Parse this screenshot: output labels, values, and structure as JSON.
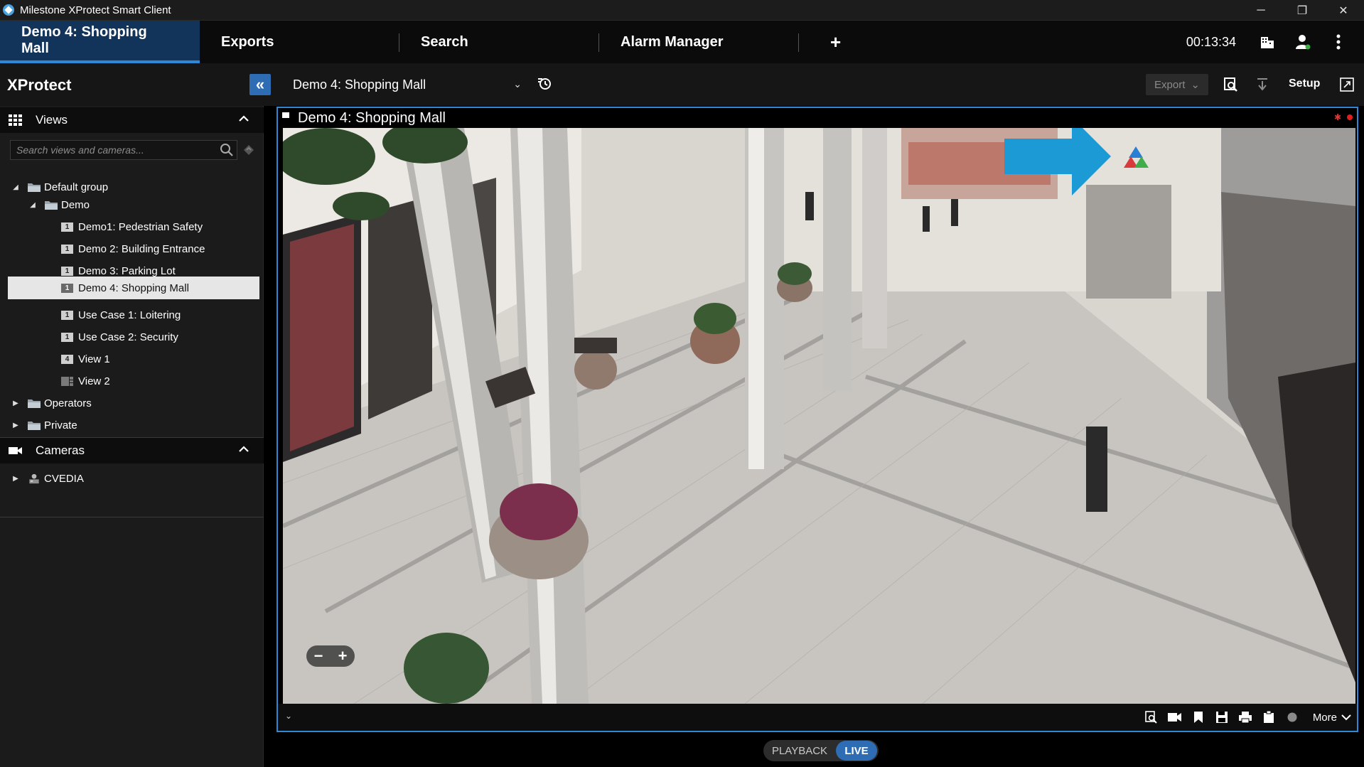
{
  "window": {
    "title": "Milestone XProtect Smart Client",
    "controls": [
      "─",
      "❐",
      "✕"
    ]
  },
  "tabs": [
    {
      "label": "Demo 4: Shopping Mall",
      "active": true
    },
    {
      "label": "Exports",
      "active": false
    },
    {
      "label": "Search",
      "active": false
    },
    {
      "label": "Alarm Manager",
      "active": false
    }
  ],
  "tab_add": "+",
  "clock": "00:13:34",
  "header": {
    "brand": "XProtect",
    "collapse_glyph": "«",
    "selected_view": "Demo 4: Shopping Mall",
    "export_label": "Export",
    "setup_label": "Setup"
  },
  "views_pane": {
    "title": "Views",
    "search_placeholder": "Search views and cameras...",
    "tree": [
      {
        "label": "Default group",
        "type": "folder",
        "expanded": true,
        "level": 0
      },
      {
        "label": "Demo",
        "type": "folder",
        "expanded": true,
        "level": 1
      },
      {
        "label": "Demo1: Pedestrian Safety",
        "type": "view",
        "badge": "1",
        "level": 2
      },
      {
        "label": "Demo 2: Building Entrance",
        "type": "view",
        "badge": "1",
        "level": 2
      },
      {
        "label": "Demo 3: Parking Lot",
        "type": "view",
        "badge": "1",
        "level": 2
      },
      {
        "label": "Demo 4: Shopping Mall",
        "type": "view",
        "badge": "1",
        "level": 2,
        "selected": true
      },
      {
        "label": "Use Case 1: Loitering",
        "type": "view",
        "badge": "1",
        "level": 2
      },
      {
        "label": "Use Case 2: Security",
        "type": "view",
        "badge": "1",
        "level": 2
      },
      {
        "label": "View 1",
        "type": "view",
        "badge": "4",
        "level": 2
      },
      {
        "label": "View 2",
        "type": "view",
        "badge": "",
        "level": 2
      },
      {
        "label": "Operators",
        "type": "folder",
        "expanded": false,
        "level": 0
      },
      {
        "label": "Private",
        "type": "folder",
        "expanded": false,
        "level": 0
      }
    ]
  },
  "cameras_pane": {
    "title": "Cameras",
    "items": [
      {
        "label": "CVEDIA"
      }
    ]
  },
  "view_item": {
    "title": "Demo 4: Shopping Mall",
    "zoom_out": "−",
    "zoom_in": "+",
    "more_label": "More"
  },
  "mode": {
    "playback": "PLAYBACK",
    "live": "LIVE",
    "active": "live"
  },
  "colors": {
    "accent": "#2e88d6",
    "tab_active_bg": "#12335a",
    "overlay_arrow": "#1b9ad6",
    "recording": "#e02020"
  }
}
